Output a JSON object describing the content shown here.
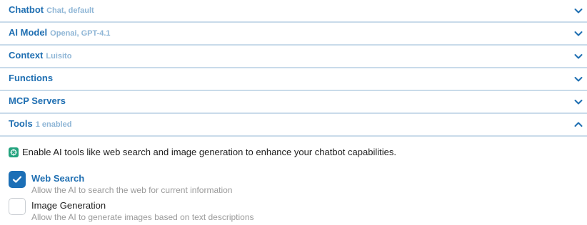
{
  "sections": [
    {
      "title": "Chatbot",
      "subtitle": "Chat, default",
      "expanded": false
    },
    {
      "title": "AI Model",
      "subtitle": "Openai, GPT-4.1",
      "expanded": false
    },
    {
      "title": "Context",
      "subtitle": "Luisito",
      "expanded": false
    },
    {
      "title": "Functions",
      "subtitle": "",
      "expanded": false
    },
    {
      "title": "MCP Servers",
      "subtitle": "",
      "expanded": false
    },
    {
      "title": "Tools",
      "subtitle": "1 enabled",
      "expanded": true
    }
  ],
  "tools": {
    "description": "Enable AI tools like web search and image generation to enhance your chatbot capabilities.",
    "icon": "openai-icon",
    "options": [
      {
        "label": "Web Search",
        "description": "Allow the AI to search the web for current information",
        "checked": true
      },
      {
        "label": "Image Generation",
        "description": "Allow the AI to generate images based on text descriptions",
        "checked": false
      }
    ]
  },
  "colors": {
    "accent": "#1f6fb2",
    "subtitle": "#8fb6d6",
    "divider": "#c9dbea",
    "checkbox_checked": "#1c6fb6"
  }
}
